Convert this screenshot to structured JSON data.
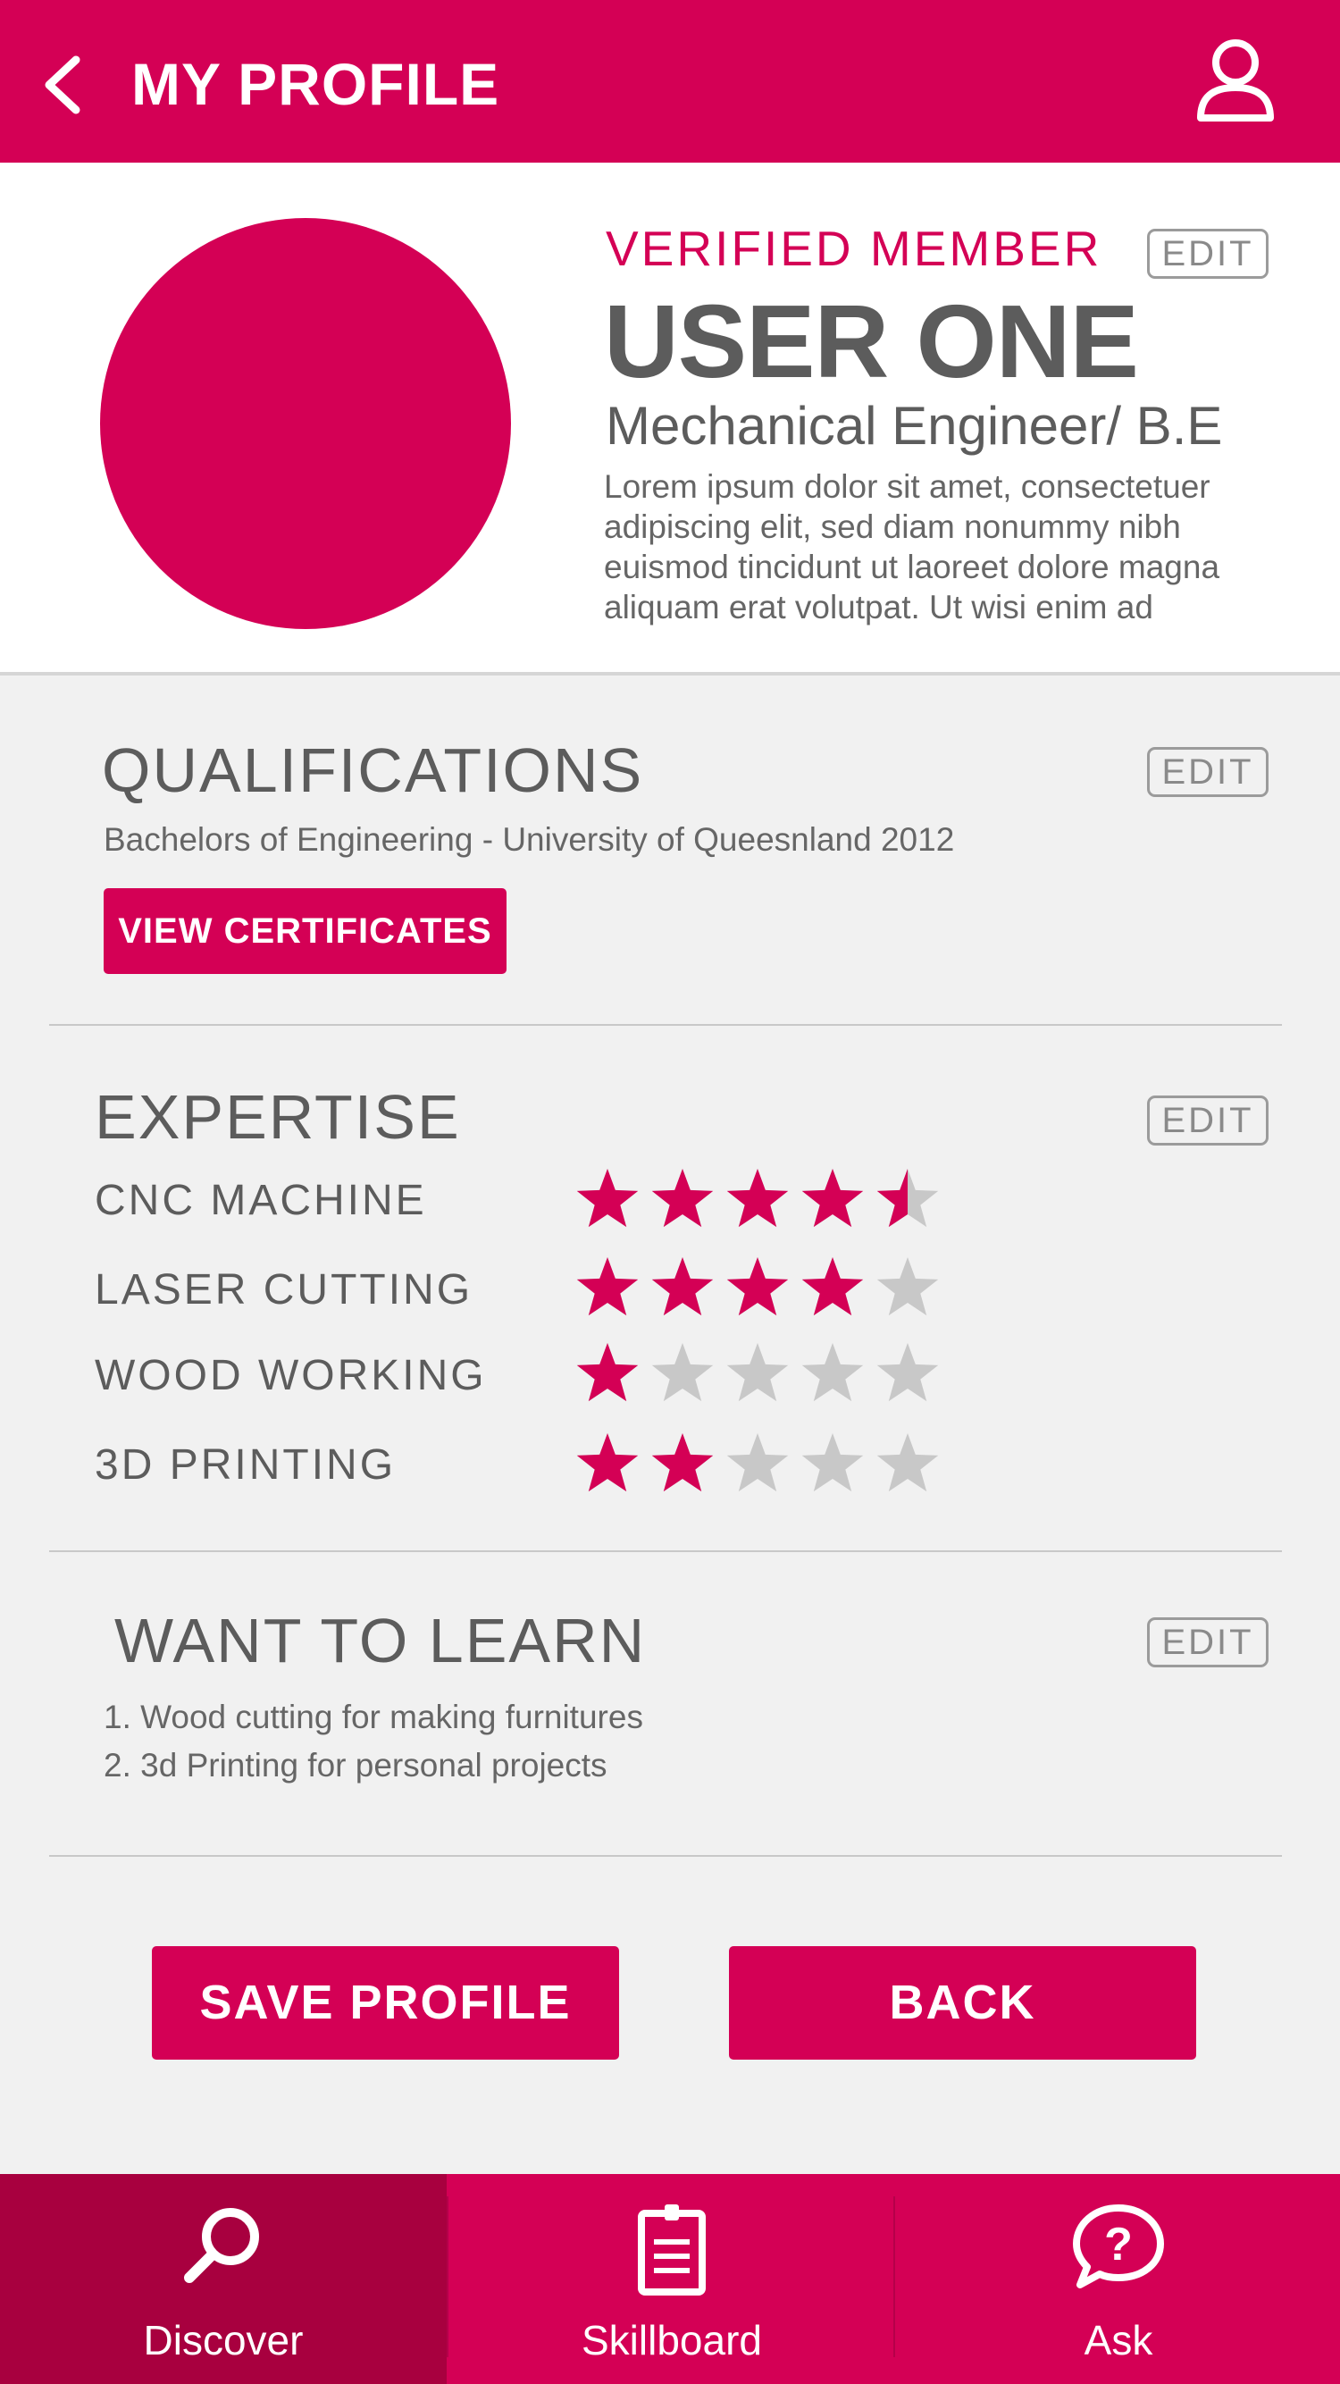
{
  "header": {
    "title": "MY PROFILE"
  },
  "profile": {
    "status": "VERIFIED MEMBER",
    "name": "USER ONE",
    "occupation": "Mechanical Engineer/ B.E",
    "bio": "Lorem ipsum dolor sit amet, consectetuer adipiscing elit, sed diam nonummy nibh euismod tincidunt ut laoreet dolore magna aliquam erat volutpat. Ut wisi enim ad",
    "edit_label": "EDIT"
  },
  "qualifications": {
    "title": "QUALIFICATIONS",
    "edit_label": "EDIT",
    "text": "Bachelors of Engineering - University of Queesnland 2012",
    "view_button": "VIEW CERTIFICATES"
  },
  "expertise": {
    "title": "EXPERTISE",
    "edit_label": "EDIT",
    "max_rating": 5,
    "skills": [
      {
        "label": "CNC MACHINE",
        "rating": 4.5
      },
      {
        "label": "LASER CUTTING",
        "rating": 4
      },
      {
        "label": "WOOD WORKING",
        "rating": 1
      },
      {
        "label": "3D PRINTING",
        "rating": 2
      }
    ]
  },
  "want_to_learn": {
    "title": "WANT TO LEARN",
    "edit_label": "EDIT",
    "items": [
      "1. Wood cutting for making furnitures",
      "2. 3d Printing for personal projects"
    ]
  },
  "actions": {
    "save_label": "SAVE PROFILE",
    "back_label": "BACK"
  },
  "tabbar": {
    "active": "Discover",
    "tabs": [
      {
        "label": "Discover",
        "icon": "search-icon"
      },
      {
        "label": "Skillboard",
        "icon": "clipboard-icon"
      },
      {
        "label": "Ask",
        "icon": "question-bubble-icon"
      }
    ]
  },
  "colors": {
    "accent": "#d40055",
    "accent_dark": "#a8003f",
    "star_empty": "#c8c8c8",
    "text": "#5c5c5c",
    "background": "#f1f1f1"
  }
}
